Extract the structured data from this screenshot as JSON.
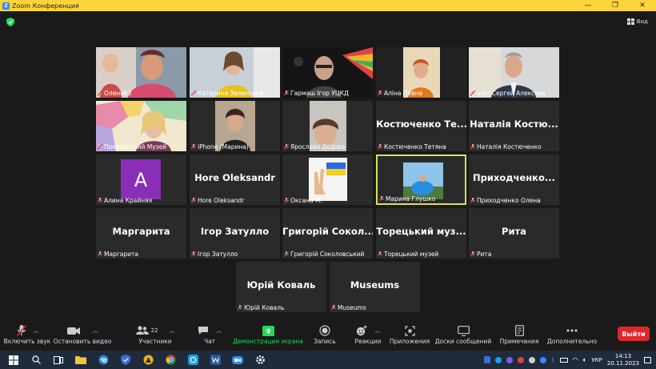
{
  "window": {
    "title": "Zoom Конференция",
    "controls": [
      "—",
      "❐",
      "✕"
    ]
  },
  "header": {
    "view_label": "Вид"
  },
  "tiles": [
    {
      "name": "Олена63",
      "big": "",
      "photo": "two-women"
    },
    {
      "name": "Катерина Зеленська",
      "big": "",
      "photo": "woman-yellow"
    },
    {
      "name": "Гармаш Ігор УЦКД",
      "big": "",
      "photo": "man-rainbow"
    },
    {
      "name": "Аліна Певна",
      "big": "",
      "photo": "woman-orange"
    },
    {
      "name": "user Сергей Алексеев",
      "big": "",
      "photo": "man-suit"
    },
    {
      "name": "Покровський Музей",
      "big": "",
      "photo": "map-woman"
    },
    {
      "name": "iPhone (Марина)",
      "big": "",
      "photo": "woman-dark"
    },
    {
      "name": "Ярослава Дєдова",
      "big": "",
      "photo": "woman-close"
    },
    {
      "name": "Костюченко Тетяна",
      "big": "Костюченко Те...",
      "photo": ""
    },
    {
      "name": "Наталія Костюченко",
      "big": "Наталія Костю...",
      "photo": ""
    },
    {
      "name": "Алина Крайняя",
      "big": "",
      "photo": "avatar-a"
    },
    {
      "name": "Hore Oleksandr",
      "big": "Hore Oleksandr",
      "photo": ""
    },
    {
      "name": "Оксана М.",
      "big": "",
      "photo": "peace-flag"
    },
    {
      "name": "Марина Глушко",
      "big": "",
      "photo": "blue-sky",
      "active": true
    },
    {
      "name": "Приходченко Олена",
      "big": "Приходченко...",
      "photo": ""
    },
    {
      "name": "Маргарита",
      "big": "Маргарита",
      "photo": ""
    },
    {
      "name": "Ігор Затулло",
      "big": "Ігор Затулло",
      "photo": ""
    },
    {
      "name": "Григорій Соколовський",
      "big": "Григорій Сокол...",
      "photo": ""
    },
    {
      "name": "Торецький музей",
      "big": "Торецький муз...",
      "photo": ""
    },
    {
      "name": "Рита",
      "big": "Рита",
      "photo": ""
    },
    {
      "name": "Юрій Коваль",
      "big": "Юрій Коваль",
      "photo": ""
    },
    {
      "name": "Museums",
      "big": "Museums",
      "photo": ""
    }
  ],
  "avatar_letter": "A",
  "toolbar": {
    "unmute": "Включить звук",
    "stop_video": "Остановить видео",
    "participants": "Участники",
    "participants_count": "22",
    "chat": "Чат",
    "share": "Демонстрация экрана",
    "record": "Запись",
    "reactions": "Реакции",
    "apps": "Приложения",
    "whiteboards": "Доски сообщений",
    "notes": "Примечания",
    "more": "Дополнительно",
    "leave": "Выйти"
  },
  "taskbar": {
    "lang": "УКР",
    "time": "14:13",
    "date": "20.11.2023"
  },
  "colors": {
    "titlebar": "#ffd43b",
    "tile": "#2a2a2a",
    "active_border": "#d8e060",
    "leave": "#e0262c",
    "share": "#23d959",
    "muted": "#e0262c"
  }
}
